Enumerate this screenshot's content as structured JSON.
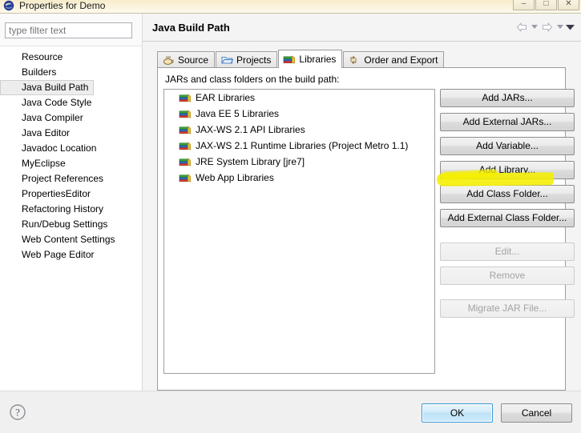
{
  "window": {
    "title": "Properties for Demo",
    "icon": "eclipse-properties-icon",
    "controls": [
      {
        "name": "minimize-button",
        "glyph": "–"
      },
      {
        "name": "restore-button",
        "glyph": "□"
      },
      {
        "name": "close-button",
        "glyph": "✕"
      }
    ]
  },
  "sidebar": {
    "filter": {
      "placeholder": "type filter text",
      "value": ""
    },
    "items": [
      {
        "label": "Resource",
        "selected": false
      },
      {
        "label": "Builders",
        "selected": false
      },
      {
        "label": "Java Build Path",
        "selected": true
      },
      {
        "label": "Java Code Style",
        "selected": false
      },
      {
        "label": "Java Compiler",
        "selected": false
      },
      {
        "label": "Java Editor",
        "selected": false
      },
      {
        "label": "Javadoc Location",
        "selected": false
      },
      {
        "label": "MyEclipse",
        "selected": false
      },
      {
        "label": "Project References",
        "selected": false
      },
      {
        "label": "PropertiesEditor",
        "selected": false
      },
      {
        "label": "Refactoring History",
        "selected": false
      },
      {
        "label": "Run/Debug Settings",
        "selected": false
      },
      {
        "label": "Web Content Settings",
        "selected": false
      },
      {
        "label": "Web Page Editor",
        "selected": false
      }
    ]
  },
  "page": {
    "title": "Java Build Path",
    "nav": {
      "back": "back-arrow-icon",
      "back_menu": "back-dropdown-caret-icon",
      "forward": "forward-arrow-icon",
      "forward_menu": "forward-dropdown-caret-icon",
      "menu": "view-menu-caret-icon"
    }
  },
  "tabs": [
    {
      "label": "Source",
      "icon": "java-source-icon",
      "active": false
    },
    {
      "label": "Projects",
      "icon": "folder-icon",
      "active": false
    },
    {
      "label": "Libraries",
      "icon": "library-books-icon",
      "active": true
    },
    {
      "label": "Order and Export",
      "icon": "order-export-icon",
      "active": false
    }
  ],
  "libraries_tab": {
    "list_label": "JARs and class folders on the build path:",
    "entries": [
      {
        "label": "EAR Libraries",
        "icon": "library-books-icon"
      },
      {
        "label": "Java EE 5 Libraries",
        "icon": "library-books-icon"
      },
      {
        "label": "JAX-WS 2.1 API Libraries",
        "icon": "library-books-icon"
      },
      {
        "label": "JAX-WS 2.1 Runtime Libraries (Project Metro 1.1)",
        "icon": "library-books-icon"
      },
      {
        "label": "JRE System Library [jre7]",
        "icon": "library-books-icon"
      },
      {
        "label": "Web App Libraries",
        "icon": "library-books-icon"
      }
    ],
    "buttons": [
      {
        "label": "Add JARs...",
        "name": "add-jars-button",
        "disabled": false,
        "group": 1,
        "highlighted": false
      },
      {
        "label": "Add External JARs...",
        "name": "add-external-jars-button",
        "disabled": false,
        "group": 1,
        "highlighted": false
      },
      {
        "label": "Add Variable...",
        "name": "add-variable-button",
        "disabled": false,
        "group": 1,
        "highlighted": false
      },
      {
        "label": "Add Library...",
        "name": "add-library-button",
        "disabled": false,
        "group": 1,
        "highlighted": true
      },
      {
        "label": "Add Class Folder...",
        "name": "add-class-folder-button",
        "disabled": false,
        "group": 1,
        "highlighted": false
      },
      {
        "label": "Add External Class Folder...",
        "name": "add-external-class-folder-button",
        "disabled": false,
        "group": 1,
        "highlighted": false
      },
      {
        "label": "Edit...",
        "name": "edit-button",
        "disabled": true,
        "group": 2,
        "highlighted": false
      },
      {
        "label": "Remove",
        "name": "remove-button",
        "disabled": true,
        "group": 2,
        "highlighted": false
      },
      {
        "label": "Migrate JAR File...",
        "name": "migrate-jar-file-button",
        "disabled": true,
        "group": 3,
        "highlighted": false
      }
    ]
  },
  "footer": {
    "help_icon": "help-question-icon",
    "ok_label": "OK",
    "cancel_label": "Cancel"
  },
  "colors": {
    "titlebar": "#faf2dc",
    "highlight_marker": "#f5f000",
    "default_button_border": "#3c9ad6",
    "selection": "#ededed"
  }
}
